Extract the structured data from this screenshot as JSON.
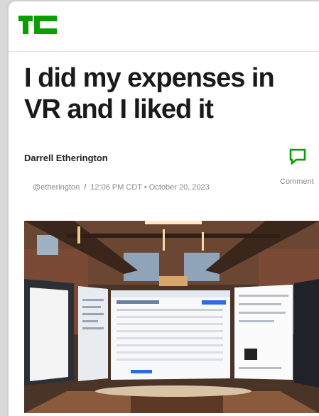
{
  "header": {
    "logo": "TC",
    "logo_color": "#0a9e01"
  },
  "article": {
    "title": "I did my expenses in VR and I liked it",
    "author": "Darrell Etherington",
    "handle": "@etherington",
    "separator": "/",
    "timestamp": "12:06 PM CDT • October 20, 2023",
    "comment_label": "Comment",
    "comment_icon": "speech-bubble-icon"
  },
  "hero_image": {
    "description_icon": "vr-office-photo"
  }
}
